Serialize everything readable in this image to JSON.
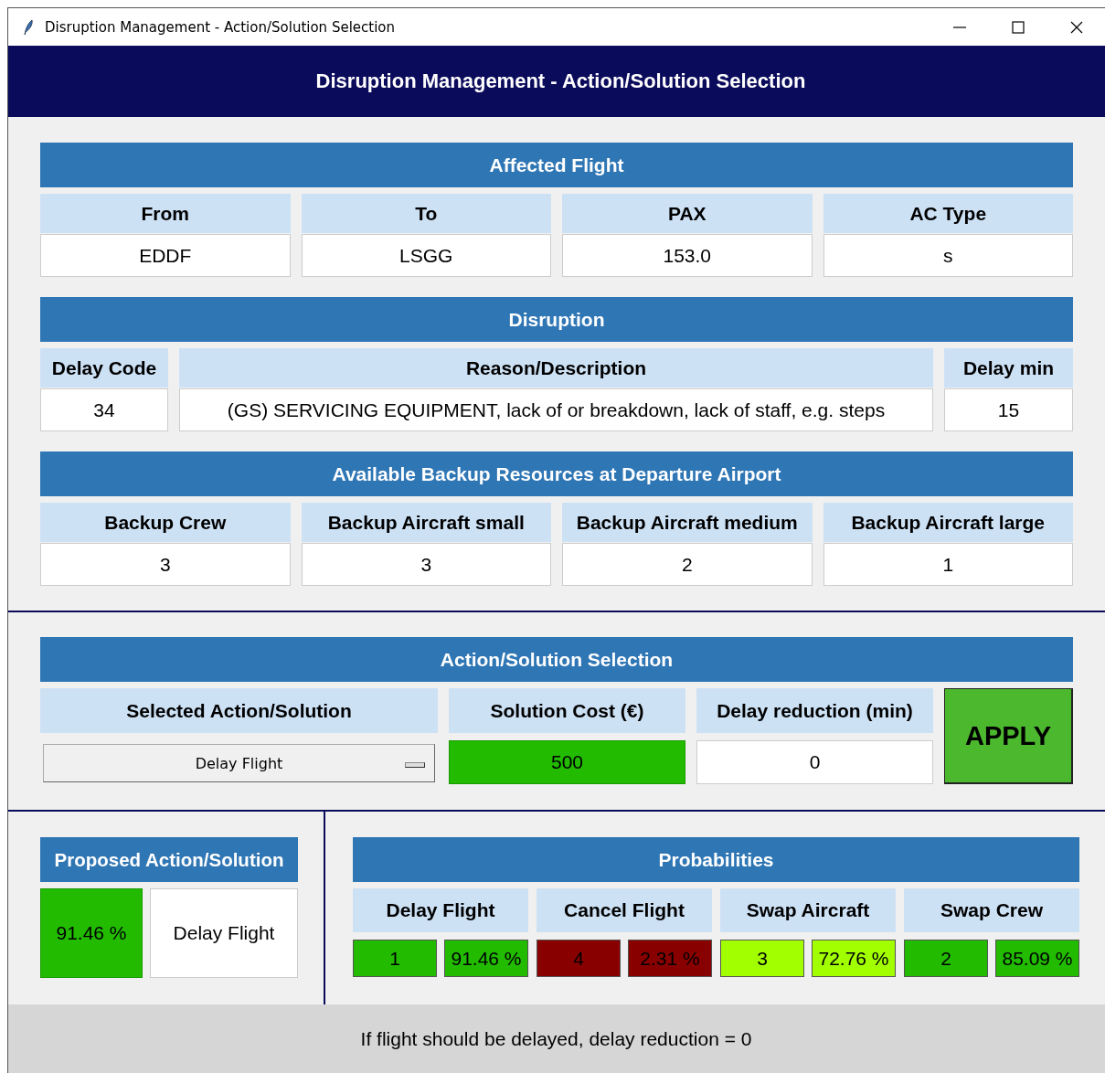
{
  "window": {
    "title": "Disruption Management - Action/Solution Selection"
  },
  "header": {
    "title": "Disruption Management - Action/Solution Selection"
  },
  "affected_flight": {
    "title": "Affected Flight",
    "fields": [
      {
        "label": "From",
        "value": "EDDF"
      },
      {
        "label": "To",
        "value": "LSGG"
      },
      {
        "label": "PAX",
        "value": "153.0"
      },
      {
        "label": "AC Type",
        "value": "s"
      }
    ]
  },
  "disruption": {
    "title": "Disruption",
    "fields": [
      {
        "label": "Delay Code",
        "value": "34"
      },
      {
        "label": "Reason/Description",
        "value": "(GS) SERVICING EQUIPMENT, lack of or breakdown, lack of staff, e.g. steps"
      },
      {
        "label": "Delay min",
        "value": "15"
      }
    ]
  },
  "backup_resources": {
    "title": "Available Backup Resources at Departure Airport",
    "fields": [
      {
        "label": "Backup Crew",
        "value": "3"
      },
      {
        "label": "Backup Aircraft small",
        "value": "3"
      },
      {
        "label": "Backup Aircraft medium",
        "value": "2"
      },
      {
        "label": "Backup Aircraft large",
        "value": "1"
      }
    ]
  },
  "action_selection": {
    "title": "Action/Solution Selection",
    "selected_label": "Selected Action/Solution",
    "selected_value": "Delay Flight",
    "cost_label": "Solution Cost (€)",
    "cost_value": "500",
    "reduction_label": "Delay reduction (min)",
    "reduction_value": "0",
    "apply_button": "APPLY"
  },
  "proposed": {
    "title": "Proposed Action/Solution",
    "percent": "91.46 %",
    "action": "Delay Flight"
  },
  "probabilities": {
    "title": "Probabilities",
    "items": [
      {
        "label": "Delay Flight",
        "rank": "1",
        "percent": "91.46 %",
        "color": "#22bb00"
      },
      {
        "label": "Cancel Flight",
        "rank": "4",
        "percent": "2.31 %",
        "color": "#880000"
      },
      {
        "label": "Swap Aircraft",
        "rank": "3",
        "percent": "72.76 %",
        "color": "#a2ff00"
      },
      {
        "label": "Swap Crew",
        "rank": "2",
        "percent": "85.09 %",
        "color": "#22bb00"
      }
    ]
  },
  "status_bar": {
    "text": "If flight should be delayed, delay reduction = 0"
  }
}
